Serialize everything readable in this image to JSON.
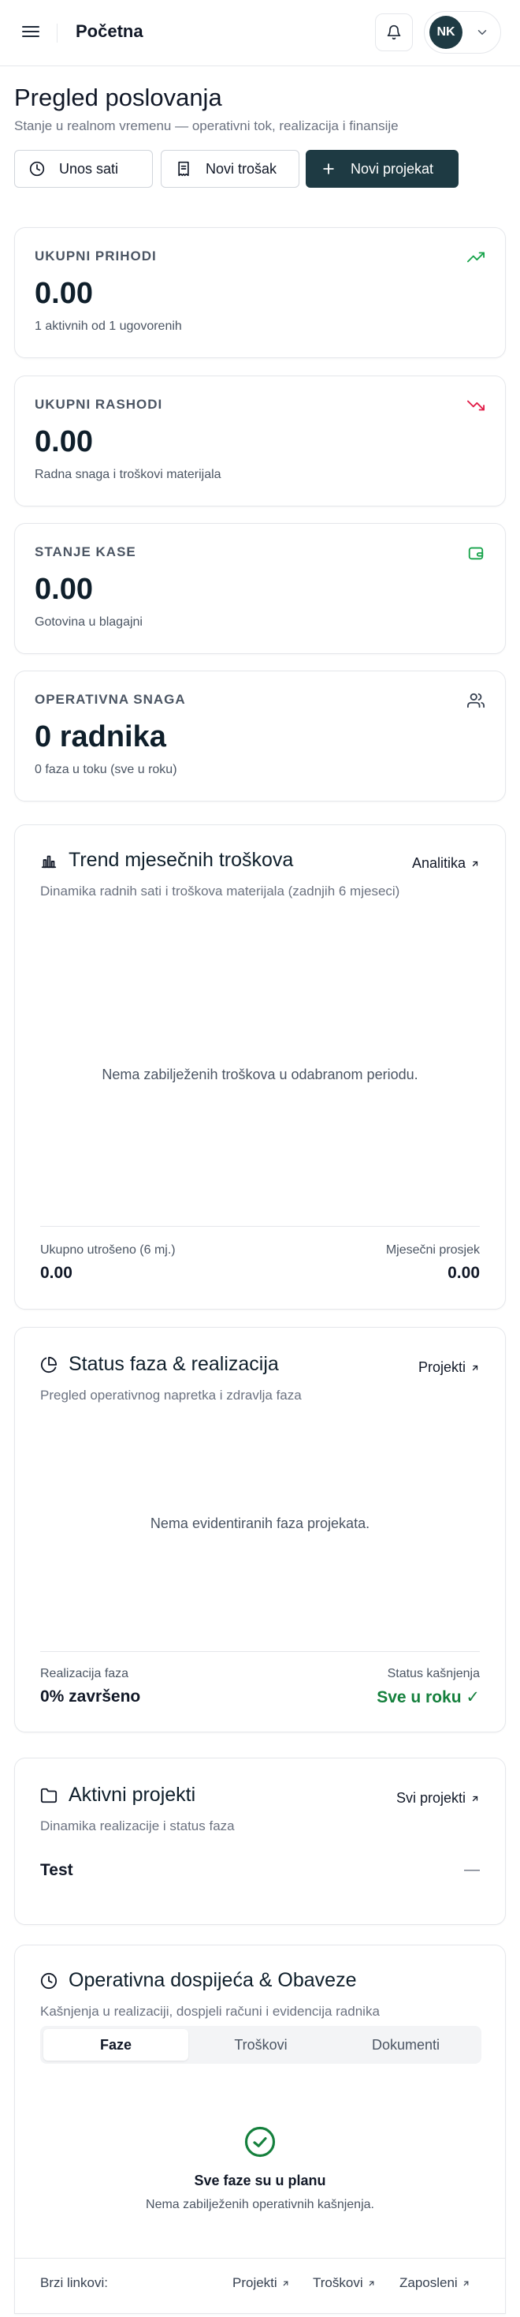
{
  "header": {
    "title": "Početna",
    "user_initials": "NK"
  },
  "page": {
    "title": "Pregled poslovanja",
    "subtitle": "Stanje u realnom vremenu — operativni tok, realizacija i finansije"
  },
  "actions": {
    "log_hours": "Unos sati",
    "new_expense": "Novi trošak",
    "new_project": "Novi projekat"
  },
  "stats": [
    {
      "label": "UKUPNI PRIHODI",
      "value": "0.00",
      "note": "1 aktivnih od 1 ugovorenih",
      "icon": "trending-up-icon",
      "color": "#16a34a"
    },
    {
      "label": "UKUPNI RASHODI",
      "value": "0.00",
      "note": "Radna snaga i troškovi materijala",
      "icon": "trending-down-icon",
      "color": "#e11d48"
    },
    {
      "label": "STANJE KASE",
      "value": "0.00",
      "note": "Gotovina u blagajni",
      "icon": "wallet-icon",
      "color": "#16a34a"
    },
    {
      "label": "OPERATIVNA SNAGA",
      "value": "0 radnika",
      "note": "0 faza u toku (sve u roku)",
      "icon": "users-icon",
      "color": "#374151"
    }
  ],
  "trend": {
    "title": "Trend mjesečnih troškova",
    "subtitle": "Dinamika radnih sati i troškova materijala (zadnjih 6 mjeseci)",
    "link": "Analitika",
    "empty": "Nema zabilježenih troškova u odabranom periodu.",
    "total_label": "Ukupno utrošeno (6 mj.)",
    "total_value": "0.00",
    "avg_label": "Mjesečni prosjek",
    "avg_value": "0.00"
  },
  "phases": {
    "title": "Status faza & realizacija",
    "subtitle": "Pregled operativnog napretka i zdravlja faza",
    "link": "Projekti",
    "empty": "Nema evidentiranih faza projekata.",
    "realization_label": "Realizacija faza",
    "realization_value": "0% završeno",
    "delay_label": "Status kašnjenja",
    "delay_value": "Sve u roku ✓",
    "ok_color": "#15803d"
  },
  "projects": {
    "title": "Aktivni projekti",
    "subtitle": "Dinamika realizacije i status faza",
    "link": "Svi projekti",
    "items": [
      {
        "name": "Test",
        "status": "—"
      }
    ]
  },
  "deadlines": {
    "title": "Operativna dospijeća & Obaveze",
    "subtitle": "Kašnjenja u realizaciji, dospjeli računi i evidencija radnika",
    "tabs": [
      "Faze",
      "Troškovi",
      "Dokumenti"
    ],
    "active_tab": "Faze",
    "ok_title": "Sve faze su u planu",
    "ok_sub": "Nema zabilježenih operativnih kašnjenja.",
    "quick_label": "Brzi linkovi:",
    "quick_links": [
      "Projekti",
      "Troškovi",
      "Zaposleni"
    ]
  }
}
